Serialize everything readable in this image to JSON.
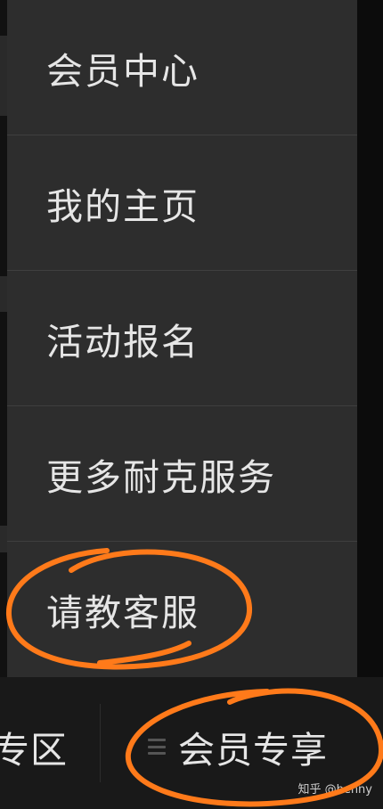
{
  "menu": {
    "items": [
      {
        "label": "会员中心"
      },
      {
        "label": "我的主页"
      },
      {
        "label": "活动报名"
      },
      {
        "label": "更多耐克服务"
      },
      {
        "label": "请教客服"
      }
    ]
  },
  "tabbar": {
    "left_label": "专区",
    "right_label": "会员专享"
  },
  "watermark": "知乎 @benny",
  "colors": {
    "annotation": "#ff7a1a",
    "menu_bg": "#2d2d2d",
    "text": "#e6e6e6"
  }
}
